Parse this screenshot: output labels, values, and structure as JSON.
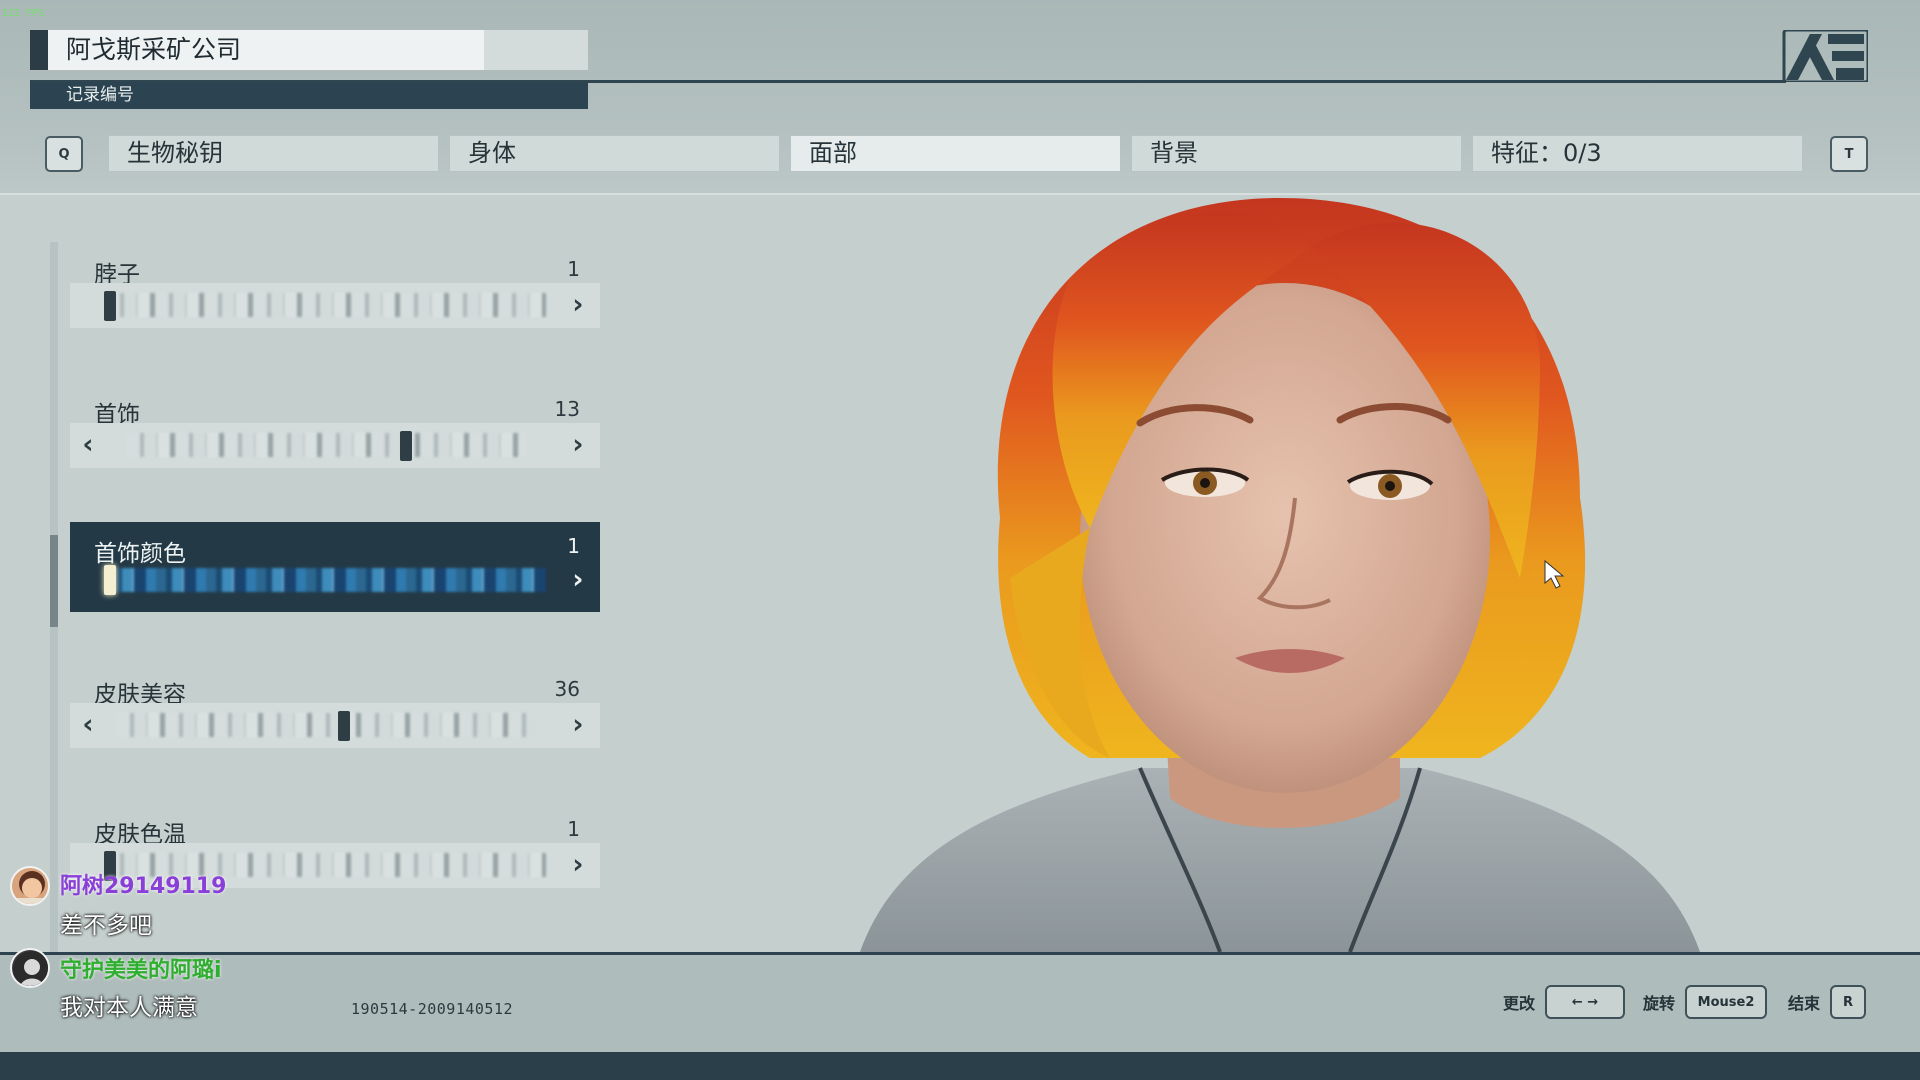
{
  "header": {
    "company_name": "阿戈斯采矿公司",
    "record_label": "记录编号",
    "left_key": "Q",
    "right_key": "T",
    "tabs": [
      {
        "label": "生物秘钥"
      },
      {
        "label": "身体"
      },
      {
        "label": "面部"
      },
      {
        "label": "背景"
      },
      {
        "label": "特征：0/3"
      }
    ],
    "active_tab": "面部"
  },
  "options": [
    {
      "label": "脖子",
      "value": "1",
      "has_left_arrow": false,
      "position": 0.0
    },
    {
      "label": "首饰",
      "value": "13",
      "has_left_arrow": true,
      "position": 0.72
    },
    {
      "label": "首饰颜色",
      "value": "1",
      "has_left_arrow": false,
      "position": 0.0,
      "selected": true
    },
    {
      "label": "皮肤美容",
      "value": "36",
      "has_left_arrow": true,
      "position": 0.51
    },
    {
      "label": "皮肤色温",
      "value": "1",
      "has_left_arrow": false,
      "position": 0.0
    }
  ],
  "chat": [
    {
      "user": "阿树29149119",
      "message": "差不多吧",
      "name_color": "#8a3fd8"
    },
    {
      "user": "守护美美的阿璐i",
      "message": "我对本人满意",
      "name_color": "#2fae2f"
    }
  ],
  "footer": {
    "record_id": "190514-2009140512",
    "controls": [
      {
        "label": "更改",
        "key": "← →"
      },
      {
        "label": "旋转",
        "key": "Mouse2"
      },
      {
        "label": "结束",
        "key": "R"
      }
    ],
    "fps": "122 FPS"
  },
  "colors": {
    "accent_dark": "#243946",
    "background": "#c5cfcd",
    "header_bg": "#b4c1c0"
  },
  "icons": {
    "logo": "constellation-logo-icon",
    "left": "chevron-left-icon",
    "right": "chevron-right-icon",
    "cursor": "mouse-cursor-icon"
  }
}
